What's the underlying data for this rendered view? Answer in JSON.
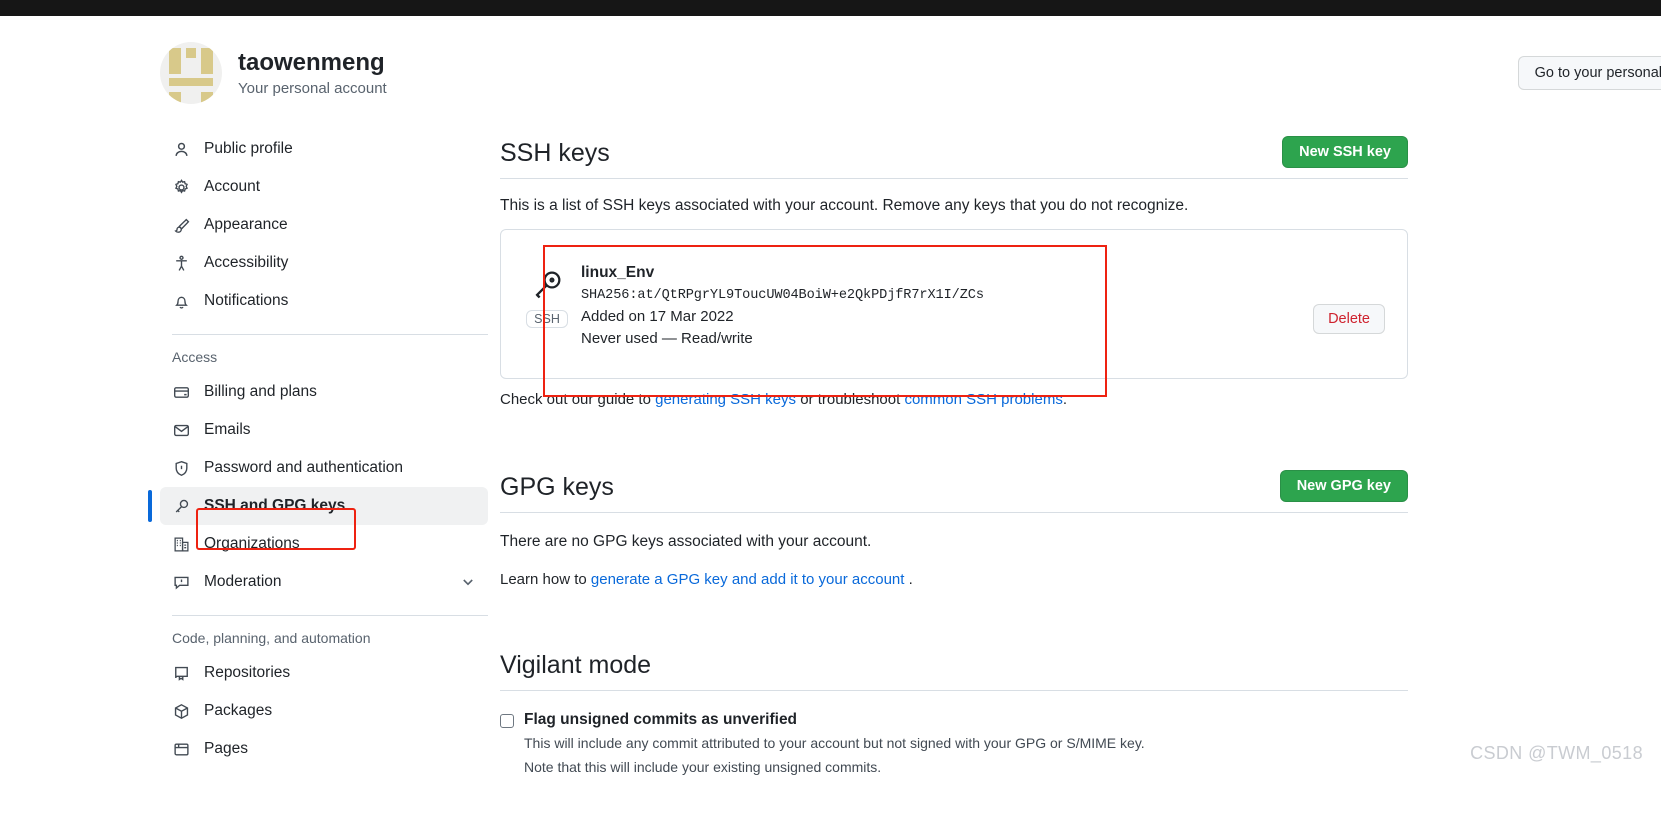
{
  "account": {
    "username": "taowenmeng",
    "subtitle": "Your personal account",
    "avatar_icon": "identicon-avatar"
  },
  "header": {
    "go_to_personal_label": "Go to your personal"
  },
  "sidebar": {
    "primary_items": [
      {
        "label": "Public profile",
        "icon": "person-icon"
      },
      {
        "label": "Account",
        "icon": "gear-icon"
      },
      {
        "label": "Appearance",
        "icon": "paintbrush-icon"
      },
      {
        "label": "Accessibility",
        "icon": "accessibility-icon"
      },
      {
        "label": "Notifications",
        "icon": "bell-icon"
      }
    ],
    "access_group_title": "Access",
    "access_items": [
      {
        "label": "Billing and plans",
        "icon": "credit-card-icon"
      },
      {
        "label": "Emails",
        "icon": "mail-icon"
      },
      {
        "label": "Password and authentication",
        "icon": "shield-icon"
      },
      {
        "label": "SSH and GPG keys",
        "icon": "key-icon",
        "selected": true
      },
      {
        "label": "Organizations",
        "icon": "organization-icon"
      },
      {
        "label": "Moderation",
        "icon": "report-icon",
        "has_chevron": true
      }
    ],
    "code_group_title": "Code, planning, and automation",
    "code_items": [
      {
        "label": "Repositories",
        "icon": "repo-icon"
      },
      {
        "label": "Packages",
        "icon": "package-icon"
      },
      {
        "label": "Pages",
        "icon": "browser-icon"
      }
    ]
  },
  "ssh_section": {
    "title": "SSH keys",
    "new_button": "New SSH key",
    "description": "This is a list of SSH keys associated with your account. Remove any keys that you do not recognize.",
    "keys": [
      {
        "name": "linux_Env",
        "fingerprint": "SHA256:at/QtRPgrYL9ToucUW04BoiW+e2QkPDjfR7rX1I/ZCs",
        "added": "Added on 17 Mar 2022",
        "usage": "Never used — Read/write",
        "badge": "SSH",
        "delete_label": "Delete",
        "icon": "key-icon"
      }
    ],
    "guide_prefix": "Check out our guide to ",
    "guide_link1": "generating SSH keys",
    "guide_middle": " or troubleshoot ",
    "guide_link2": "common SSH problems",
    "guide_suffix": "."
  },
  "gpg_section": {
    "title": "GPG keys",
    "new_button": "New GPG key",
    "empty_text": "There are no GPG keys associated with your account.",
    "learn_prefix": "Learn how to ",
    "learn_link": "generate a GPG key and add it to your account",
    "learn_suffix": " ."
  },
  "vigilant_section": {
    "title": "Vigilant mode",
    "checkbox_label": "Flag unsigned commits as unverified",
    "note_line1": "This will include any commit attributed to your account but not signed with your GPG or S/MIME key.",
    "note_line2": "Note that this will include your existing unsigned commits.",
    "checked": false
  },
  "watermark": "CSDN @TWM_0518",
  "colors": {
    "green": "#2da44e",
    "link": "#0969da",
    "danger": "#cf222e",
    "annotation": "#ee2211",
    "selected_bar": "#0969da"
  }
}
